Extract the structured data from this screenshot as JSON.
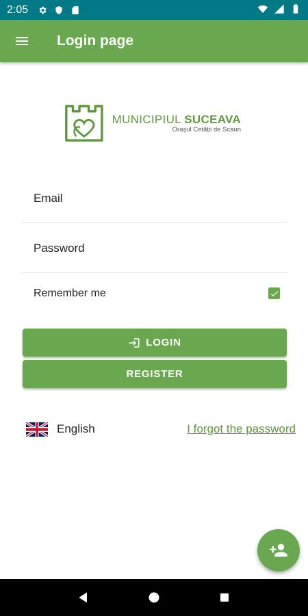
{
  "status_bar": {
    "time": "2:05",
    "icons": [
      "gear-icon",
      "shield-icon",
      "sim-card-icon",
      "wifi-icon",
      "signal-icon",
      "battery-icon"
    ]
  },
  "app_bar": {
    "title": "Login page",
    "menu_icon": "hamburger-menu-icon",
    "color": "#6aa84f"
  },
  "logo": {
    "main_prefix": "MUNICIPIUL ",
    "main_bold": "SUCEAVA",
    "sub": "Orașul Cetății de Scaun"
  },
  "form": {
    "email_placeholder": "Email",
    "password_placeholder": "Password",
    "remember_label": "Remember me",
    "remember_checked": true
  },
  "buttons": {
    "login": "LOGIN",
    "register": "REGISTER"
  },
  "language": {
    "label": "English",
    "flag_icon": "uk-flag-icon"
  },
  "links": {
    "forgot_password": "I forgot the password"
  },
  "fab": {
    "icon": "add-user-icon"
  },
  "navigation": {
    "icons": [
      "back-icon",
      "home-icon",
      "recents-icon"
    ]
  },
  "colors": {
    "status_bar": "#007a87",
    "accent": "#6aa84f",
    "link": "#5b9a36"
  }
}
